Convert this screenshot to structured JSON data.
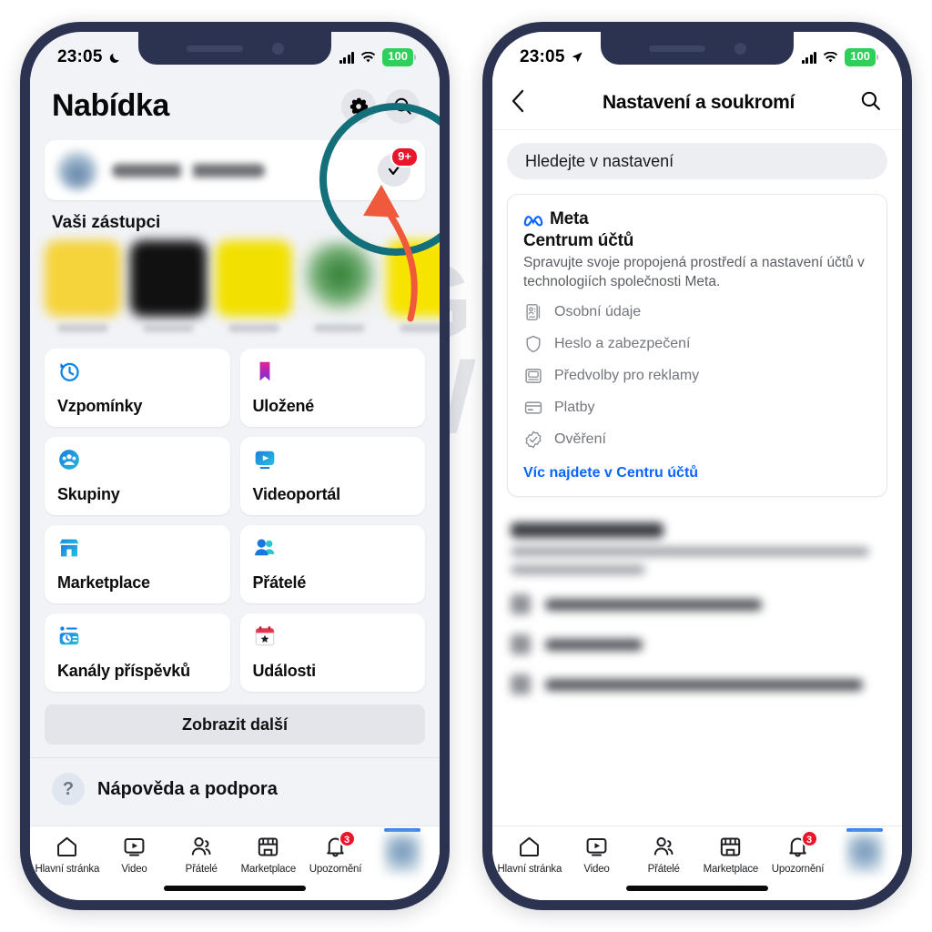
{
  "meta_info": {
    "watermark_line1": "GE",
    "watermark_line2": "WO"
  },
  "left_phone": {
    "status": {
      "time": "23:05",
      "moon_icon": "crescent-moon-icon",
      "battery": "100"
    },
    "header": {
      "title": "Nabídka",
      "settings_icon": "gear-icon",
      "search_icon": "search-icon"
    },
    "profile_row": {
      "check_icon": "check-icon",
      "badge": "9+"
    },
    "reps_section_title": "Vaši zástupci",
    "avatars": [
      {
        "name": "avatar-1",
        "color": "#f5d33a"
      },
      {
        "name": "avatar-2",
        "color": "#111111"
      },
      {
        "name": "avatar-3",
        "color": "#f2e000"
      },
      {
        "name": "avatar-4",
        "color": "#eef0ea"
      },
      {
        "name": "avatar-5",
        "color": "#f6e300"
      }
    ],
    "tiles": [
      {
        "label": "Vzpomínky",
        "icon": "memories-clock-icon"
      },
      {
        "label": "Uložené",
        "icon": "bookmark-icon"
      },
      {
        "label": "Skupiny",
        "icon": "groups-icon"
      },
      {
        "label": "Videoportál",
        "icon": "video-icon"
      },
      {
        "label": "Marketplace",
        "icon": "storefront-icon"
      },
      {
        "label": "Přátelé",
        "icon": "friends-icon"
      },
      {
        "label": "Kanály příspěvků",
        "icon": "feeds-icon"
      },
      {
        "label": "Události",
        "icon": "calendar-star-icon"
      }
    ],
    "show_more": "Zobrazit další",
    "cut_row": {
      "label": "Nápověda a podpora",
      "icon": "question-circle-icon"
    },
    "tabs": [
      {
        "label": "Hlavní stránka",
        "icon": "home-icon",
        "badge": ""
      },
      {
        "label": "Video",
        "icon": "video-play-icon",
        "badge": ""
      },
      {
        "label": "Přátelé",
        "icon": "friends-icon",
        "badge": ""
      },
      {
        "label": "Marketplace",
        "icon": "storefront-icon",
        "badge": ""
      },
      {
        "label": "Upozornění",
        "icon": "bell-icon",
        "badge": "3"
      }
    ]
  },
  "right_phone": {
    "status": {
      "time": "23:05",
      "location_icon": "location-arrow-icon",
      "battery": "100"
    },
    "header": {
      "back_icon": "chevron-left-icon",
      "title": "Nastavení a soukromí",
      "search_icon": "search-icon"
    },
    "search": {
      "placeholder": "Hledejte v nastavení",
      "value": "Hledejte v nastavení"
    },
    "meta_card": {
      "brand": "Meta",
      "brand_icon": "meta-infinity-icon",
      "heading": "Centrum účtů",
      "description": "Spravujte svoje propojená prostředí a nastavení účtů v technologiích společnosti Meta.",
      "items": [
        {
          "label": "Osobní údaje",
          "icon": "id-card-icon"
        },
        {
          "label": "Heslo a zabezpečení",
          "icon": "shield-icon"
        },
        {
          "label": "Předvolby pro reklamy",
          "icon": "monitor-icon"
        },
        {
          "label": "Platby",
          "icon": "credit-card-icon"
        },
        {
          "label": "Ověření",
          "icon": "verified-badge-icon"
        }
      ],
      "link": "Víc najdete v Centru účtů"
    },
    "tabs": [
      {
        "label": "Hlavní stránka",
        "icon": "home-icon",
        "badge": ""
      },
      {
        "label": "Video",
        "icon": "video-play-icon",
        "badge": ""
      },
      {
        "label": "Přátelé",
        "icon": "friends-icon",
        "badge": ""
      },
      {
        "label": "Marketplace",
        "icon": "storefront-icon",
        "badge": ""
      },
      {
        "label": "Upozornění",
        "icon": "bell-icon",
        "badge": "3"
      }
    ]
  },
  "annotations": {
    "highlight_circle_color": "#136f7a",
    "left_arrow_color": "#f05a3c",
    "right_arrow_color": "#ee4523"
  }
}
